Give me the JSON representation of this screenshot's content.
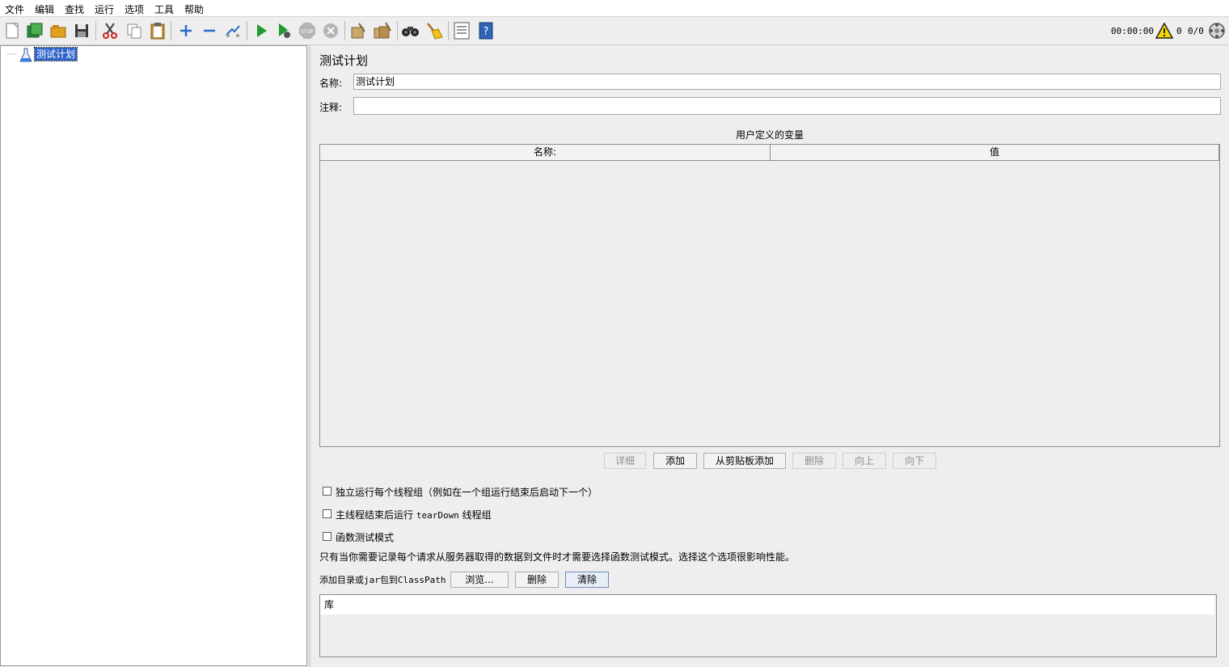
{
  "menu": [
    "文件",
    "编辑",
    "查找",
    "运行",
    "选项",
    "工具",
    "帮助"
  ],
  "toolbar": {
    "icons": [
      "new-icon",
      "templates-icon",
      "open-icon",
      "save-icon",
      "cut-icon",
      "copy-icon",
      "paste-icon",
      "expand-icon",
      "collapse-icon",
      "toggle-icon",
      "start-icon",
      "start-no-pause-icon",
      "stop-icon",
      "shutdown-icon",
      "clear-icon",
      "clear-all-icon",
      "search-icon",
      "reset-search-icon",
      "function-helper-icon",
      "help-icon"
    ],
    "timer": "00:00:00",
    "warning_count": "0",
    "threads": "0/0"
  },
  "tree": {
    "root_label": "测试计划"
  },
  "panel": {
    "title": "测试计划",
    "name_label": "名称:",
    "name_value": "测试计划",
    "comment_label": "注释:",
    "comment_value": "",
    "vars_title": "用户定义的变量",
    "vars_columns": [
      "名称:",
      "值"
    ],
    "buttons": {
      "detail": "详细",
      "add": "添加",
      "add_clipboard": "从剪贴板添加",
      "delete": "删除",
      "up": "向上",
      "down": "向下"
    },
    "checkboxes": {
      "serialize": "独立运行每个线程组（例如在一个组运行结束后启动下一个）",
      "teardown_prefix": "主线程结束后运行 ",
      "teardown_code": "tearDown",
      "teardown_suffix": " 线程组",
      "functional": "函数测试模式"
    },
    "functional_note": "只有当你需要记录每个请求从服务器取得的数据到文件时才需要选择函数测试模式。选择这个选项很影响性能。",
    "classpath_label": "添加目录或jar包到ClassPath",
    "classpath_buttons": {
      "browse": "浏览...",
      "delete": "删除",
      "clear": "清除"
    },
    "library_header": "库"
  },
  "colors": {
    "selection": "#2f65ca",
    "start_green": "#1f9a2e",
    "warning_yellow": "#f7d300"
  }
}
